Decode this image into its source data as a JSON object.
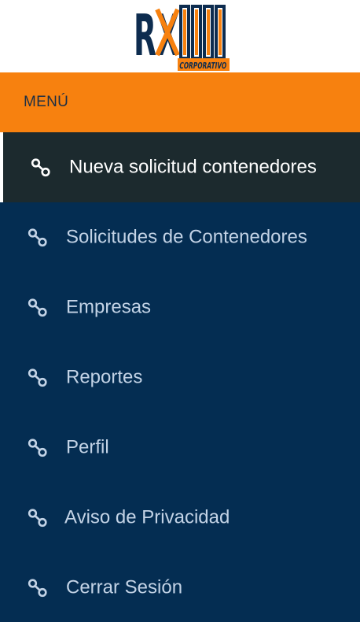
{
  "brand": {
    "logo_text": "RX",
    "logo_subtext": "CORPORATIVO"
  },
  "colors": {
    "header_orange": "#f7810f",
    "nav_navy": "#042d52",
    "active_bg": "#1c2a2e",
    "label": "#c3d3e6"
  },
  "menu": {
    "title": "MENÚ",
    "items": [
      {
        "label": "Nueva solicitud contenedores",
        "icon": "link-icon",
        "active": true
      },
      {
        "label": "Solicitudes de Contenedores",
        "icon": "link-icon",
        "active": false
      },
      {
        "label": "Empresas",
        "icon": "link-icon",
        "active": false
      },
      {
        "label": "Reportes",
        "icon": "link-icon",
        "active": false
      },
      {
        "label": "Perfil",
        "icon": "link-icon",
        "active": false
      },
      {
        "label": "Aviso de Privacidad",
        "icon": "link-icon",
        "active": false
      },
      {
        "label": "Cerrar Sesión",
        "icon": "link-icon",
        "active": false
      }
    ]
  }
}
